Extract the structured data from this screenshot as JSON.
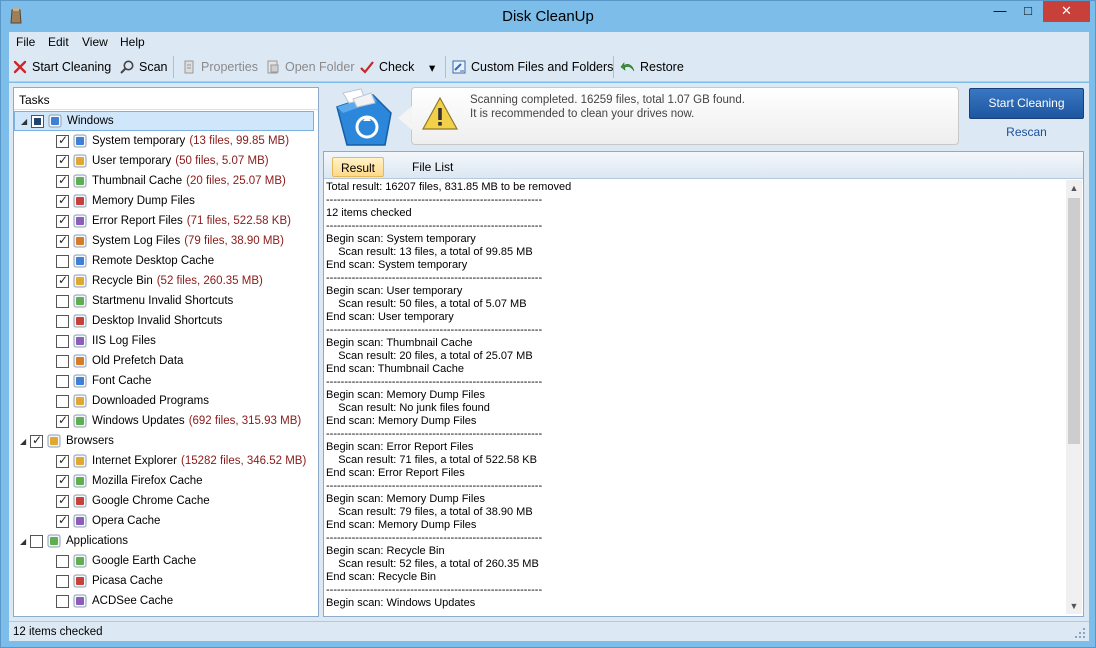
{
  "window": {
    "title": "Disk CleanUp",
    "minimize": "—",
    "maximize": "□",
    "close": "✕"
  },
  "menu": [
    "File",
    "Edit",
    "View",
    "Help"
  ],
  "toolbar": {
    "start_cleaning": "Start Cleaning",
    "scan": "Scan",
    "properties": "Properties",
    "open_folder": "Open Folder",
    "check": "Check",
    "check_dropdown": "▾",
    "custom": "Custom Files and Folders",
    "restore": "Restore"
  },
  "tasks": {
    "header": "Tasks",
    "groups": [
      {
        "label": "Windows",
        "icon": "windows-logo-icon",
        "expander": "◢",
        "state": "partial",
        "items": [
          {
            "label": "System temporary",
            "stat": "(13 files, 99.85 MB)",
            "checked": true,
            "icon": "windows-flag-icon"
          },
          {
            "label": "User temporary",
            "stat": "(50 files, 5.07 MB)",
            "checked": true,
            "icon": "windows-flag-icon"
          },
          {
            "label": "Thumbnail Cache",
            "stat": "(20 files, 25.07 MB)",
            "checked": true,
            "icon": "thumbnail-icon"
          },
          {
            "label": "Memory Dump Files",
            "stat": "",
            "checked": true,
            "icon": "memory-icon"
          },
          {
            "label": "Error Report Files",
            "stat": "(71 files, 522.58 KB)",
            "checked": true,
            "icon": "error-report-icon"
          },
          {
            "label": "System Log Files",
            "stat": "(79 files, 38.90 MB)",
            "checked": true,
            "icon": "log-icon"
          },
          {
            "label": "Remote Desktop Cache",
            "stat": "",
            "checked": false,
            "icon": "remote-desktop-icon"
          },
          {
            "label": "Recycle Bin",
            "stat": "(52 files, 260.35 MB)",
            "checked": true,
            "icon": "recycle-bin-icon"
          },
          {
            "label": "Startmenu Invalid Shortcuts",
            "stat": "",
            "checked": false,
            "icon": "shortcut-icon"
          },
          {
            "label": "Desktop Invalid Shortcuts",
            "stat": "",
            "checked": false,
            "icon": "shortcut-icon"
          },
          {
            "label": "IIS Log Files",
            "stat": "",
            "checked": false,
            "icon": "iis-icon"
          },
          {
            "label": "Old Prefetch Data",
            "stat": "",
            "checked": false,
            "icon": "prefetch-icon"
          },
          {
            "label": "Font Cache",
            "stat": "",
            "checked": false,
            "icon": "font-icon"
          },
          {
            "label": "Downloaded Programs",
            "stat": "",
            "checked": false,
            "icon": "download-icon"
          },
          {
            "label": "Windows Updates",
            "stat": "(692 files, 315.93 MB)",
            "checked": true,
            "icon": "windows-update-icon"
          }
        ]
      },
      {
        "label": "Browsers",
        "icon": "globe-icon",
        "expander": "◢",
        "state": "checked",
        "items": [
          {
            "label": "Internet Explorer",
            "stat": "(15282 files, 346.52 MB)",
            "checked": true,
            "icon": "ie-icon"
          },
          {
            "label": "Mozilla Firefox Cache",
            "stat": "",
            "checked": true,
            "icon": "firefox-icon"
          },
          {
            "label": "Google Chrome Cache",
            "stat": "",
            "checked": true,
            "icon": "chrome-icon"
          },
          {
            "label": "Opera Cache",
            "stat": "",
            "checked": true,
            "icon": "opera-icon"
          }
        ]
      },
      {
        "label": "Applications",
        "icon": "applications-icon",
        "expander": "◢",
        "state": "unchecked",
        "items": [
          {
            "label": "Google Earth Cache",
            "stat": "",
            "checked": false,
            "icon": "google-earth-icon"
          },
          {
            "label": "Picasa Cache",
            "stat": "",
            "checked": false,
            "icon": "picasa-icon"
          },
          {
            "label": "ACDSee Cache",
            "stat": "",
            "checked": false,
            "icon": "acdsee-icon"
          }
        ]
      }
    ]
  },
  "banner": {
    "line1": "Scanning completed. 16259 files, total 1.07 GB found.",
    "line2": "It is recommended to clean your drives now.",
    "start_button": "Start Cleaning",
    "rescan": "Rescan"
  },
  "tabs": [
    "Result",
    "File List"
  ],
  "result_lines": [
    "Total result: 16207 files, 831.85 MB to be removed",
    "-----------------------------------------------------------",
    "12 items checked",
    "-----------------------------------------------------------",
    "Begin scan: System temporary",
    "    Scan result: 13 files, a total of 99.85 MB",
    "End scan: System temporary",
    "-----------------------------------------------------------",
    "Begin scan: User temporary",
    "    Scan result: 50 files, a total of 5.07 MB",
    "End scan: User temporary",
    "-----------------------------------------------------------",
    "Begin scan: Thumbnail Cache",
    "    Scan result: 20 files, a total of 25.07 MB",
    "End scan: Thumbnail Cache",
    "-----------------------------------------------------------",
    "Begin scan: Memory Dump Files",
    "    Scan result: No junk files found",
    "End scan: Memory Dump Files",
    "-----------------------------------------------------------",
    "Begin scan: Error Report Files",
    "    Scan result: 71 files, a total of 522.58 KB",
    "End scan: Error Report Files",
    "-----------------------------------------------------------",
    "Begin scan: Memory Dump Files",
    "    Scan result: 79 files, a total of 38.90 MB",
    "End scan: Memory Dump Files",
    "-----------------------------------------------------------",
    "Begin scan: Recycle Bin",
    "    Scan result: 52 files, a total of 260.35 MB",
    "End scan: Recycle Bin",
    "-----------------------------------------------------------",
    "Begin scan: Windows Updates"
  ],
  "scroll": {
    "up": "▲",
    "down": "▼"
  },
  "status": {
    "text": "12 items checked"
  },
  "colors": {
    "accent": "#1d569f",
    "stat": "#8b1a1a",
    "window": "#7cbde9"
  }
}
